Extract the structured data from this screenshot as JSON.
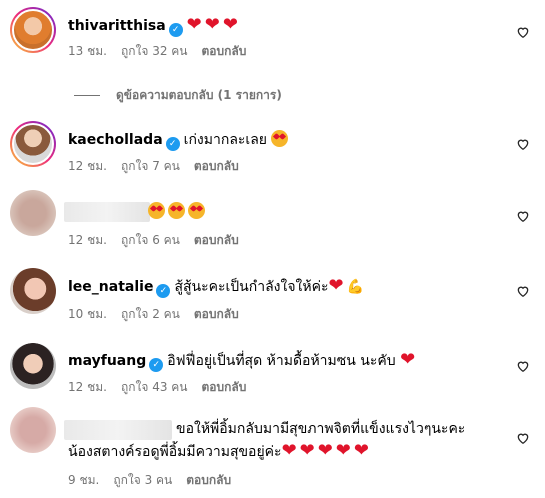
{
  "comments": [
    {
      "username": "thivaritthisa",
      "text": "",
      "hearts": "❤❤❤",
      "time": "13 ชม.",
      "likes": "ถูกใจ 32 คน",
      "reply": "ตอบกลับ"
    },
    {
      "username": "kaechollada",
      "text": "เก่งมากละเลย",
      "time": "12 ชม.",
      "likes": "ถูกใจ 7 คน",
      "reply": "ตอบกลับ"
    },
    {
      "username": "",
      "text": "",
      "time": "12 ชม.",
      "likes": "ถูกใจ 6 คน",
      "reply": "ตอบกลับ"
    },
    {
      "username": "lee_natalie",
      "text": "สู้สู้นะคะเป็นกำลังใจให้ค่ะ",
      "hearts": "❤",
      "extra_emoji": "💪",
      "time": "10 ชม.",
      "likes": "ถูกใจ 2 คน",
      "reply": "ตอบกลับ"
    },
    {
      "username": "mayfuang",
      "text": "อิฟฟี่อยู่เป็นที่สุด ห้ามดื้อห้ามซน นะคับ",
      "hearts": "❤",
      "time": "12 ชม.",
      "likes": "ถูกใจ 43 คน",
      "reply": "ตอบกลับ"
    },
    {
      "username": "",
      "text_line1": "ขอให้พี่อิ้มกลับมามีสุขภาพจิตที่แข็งแรงไวๆนะคะ",
      "text_line2": "น้องสตางค์รอดูพี่อิ้มมีความสุขอยู่ค่ะ",
      "hearts": "❤❤❤❤❤",
      "time": "9 ชม.",
      "likes": "ถูกใจ 3 คน",
      "reply": "ตอบกลับ"
    }
  ],
  "view_replies": "ดูข้อความตอบกลับ (1 รายการ)",
  "icons": {
    "verified": "verified-badge-icon",
    "like": "heart-outline-icon"
  },
  "colors": {
    "heart": "#e0142b",
    "verified": "#1d9bf0",
    "meta": "#737373"
  }
}
